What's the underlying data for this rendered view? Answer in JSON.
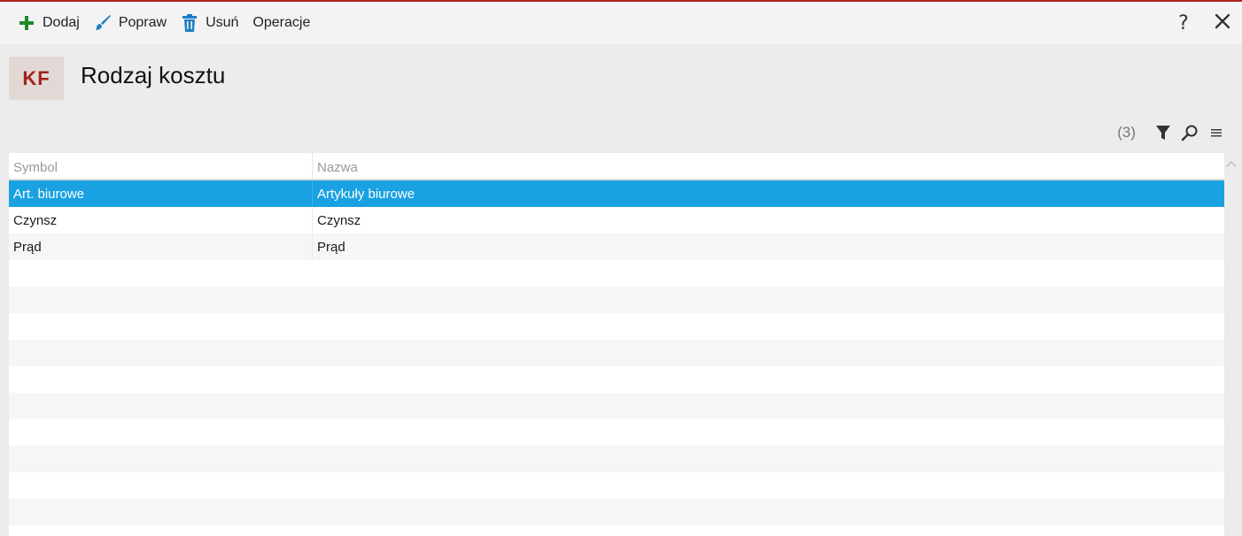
{
  "toolbar": {
    "buttons": [
      {
        "label": "Dodaj",
        "icon": "plus-icon"
      },
      {
        "label": "Popraw",
        "icon": "brush-icon"
      },
      {
        "label": "Usuń",
        "icon": "trash-icon"
      },
      {
        "label": "Operacje"
      }
    ],
    "help": "?",
    "close_icon": "close-icon"
  },
  "header": {
    "badge": "KF",
    "title": "Rodzaj kosztu"
  },
  "grid_tools": {
    "count": "(3)",
    "icons": [
      "filter-icon",
      "search-icon",
      "menu-icon"
    ]
  },
  "table": {
    "columns": [
      "Symbol",
      "Nazwa"
    ],
    "rows": [
      {
        "symbol": "Art. biurowe",
        "nazwa": "Artykuły biurowe",
        "selected": true
      },
      {
        "symbol": "Czynsz",
        "nazwa": "Czynsz"
      },
      {
        "symbol": "Prąd",
        "nazwa": "Prąd"
      }
    ],
    "empty_rows": 11
  },
  "colors": {
    "accent": "#b0201c",
    "selected_row": "#1aa1e2",
    "badge_bg": "#e2d9d6",
    "badge_text": "#a3221c",
    "add_icon": "#1f8a2b",
    "edit_icon": "#1c7fc4",
    "delete_icon": "#1c7fc4"
  }
}
